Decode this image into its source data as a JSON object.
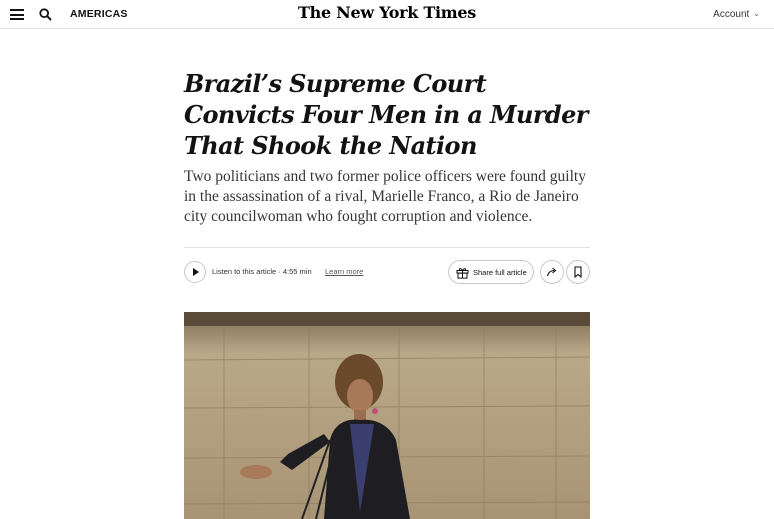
{
  "header": {
    "section": "AMERICAS",
    "masthead": "The New York Times",
    "account": "Account"
  },
  "article": {
    "headline": "Brazil’s Supreme Court Convicts Four Men in a Murder That Shook the Nation",
    "summary": "Two politicians and two former police officers were found guilty in the assassination of a rival, Marielle Franco, a Rio de Janeiro city councilwoman who fought corruption and violence."
  },
  "audio": {
    "listen_label": "Listen to this article · 4:55 min",
    "learn_more": "Learn more"
  },
  "actions": {
    "share_full": "Share full article"
  },
  "icons": {
    "menu": "hamburger-menu-icon",
    "search": "search-icon",
    "account_chevron": "chevron-down-icon",
    "play": "play-icon",
    "gift": "gift-icon",
    "share": "share-arrow-icon",
    "save": "bookmark-icon"
  },
  "colors": {
    "text": "#121212",
    "secondary_text": "#363636",
    "border": "#c8c8c8"
  }
}
